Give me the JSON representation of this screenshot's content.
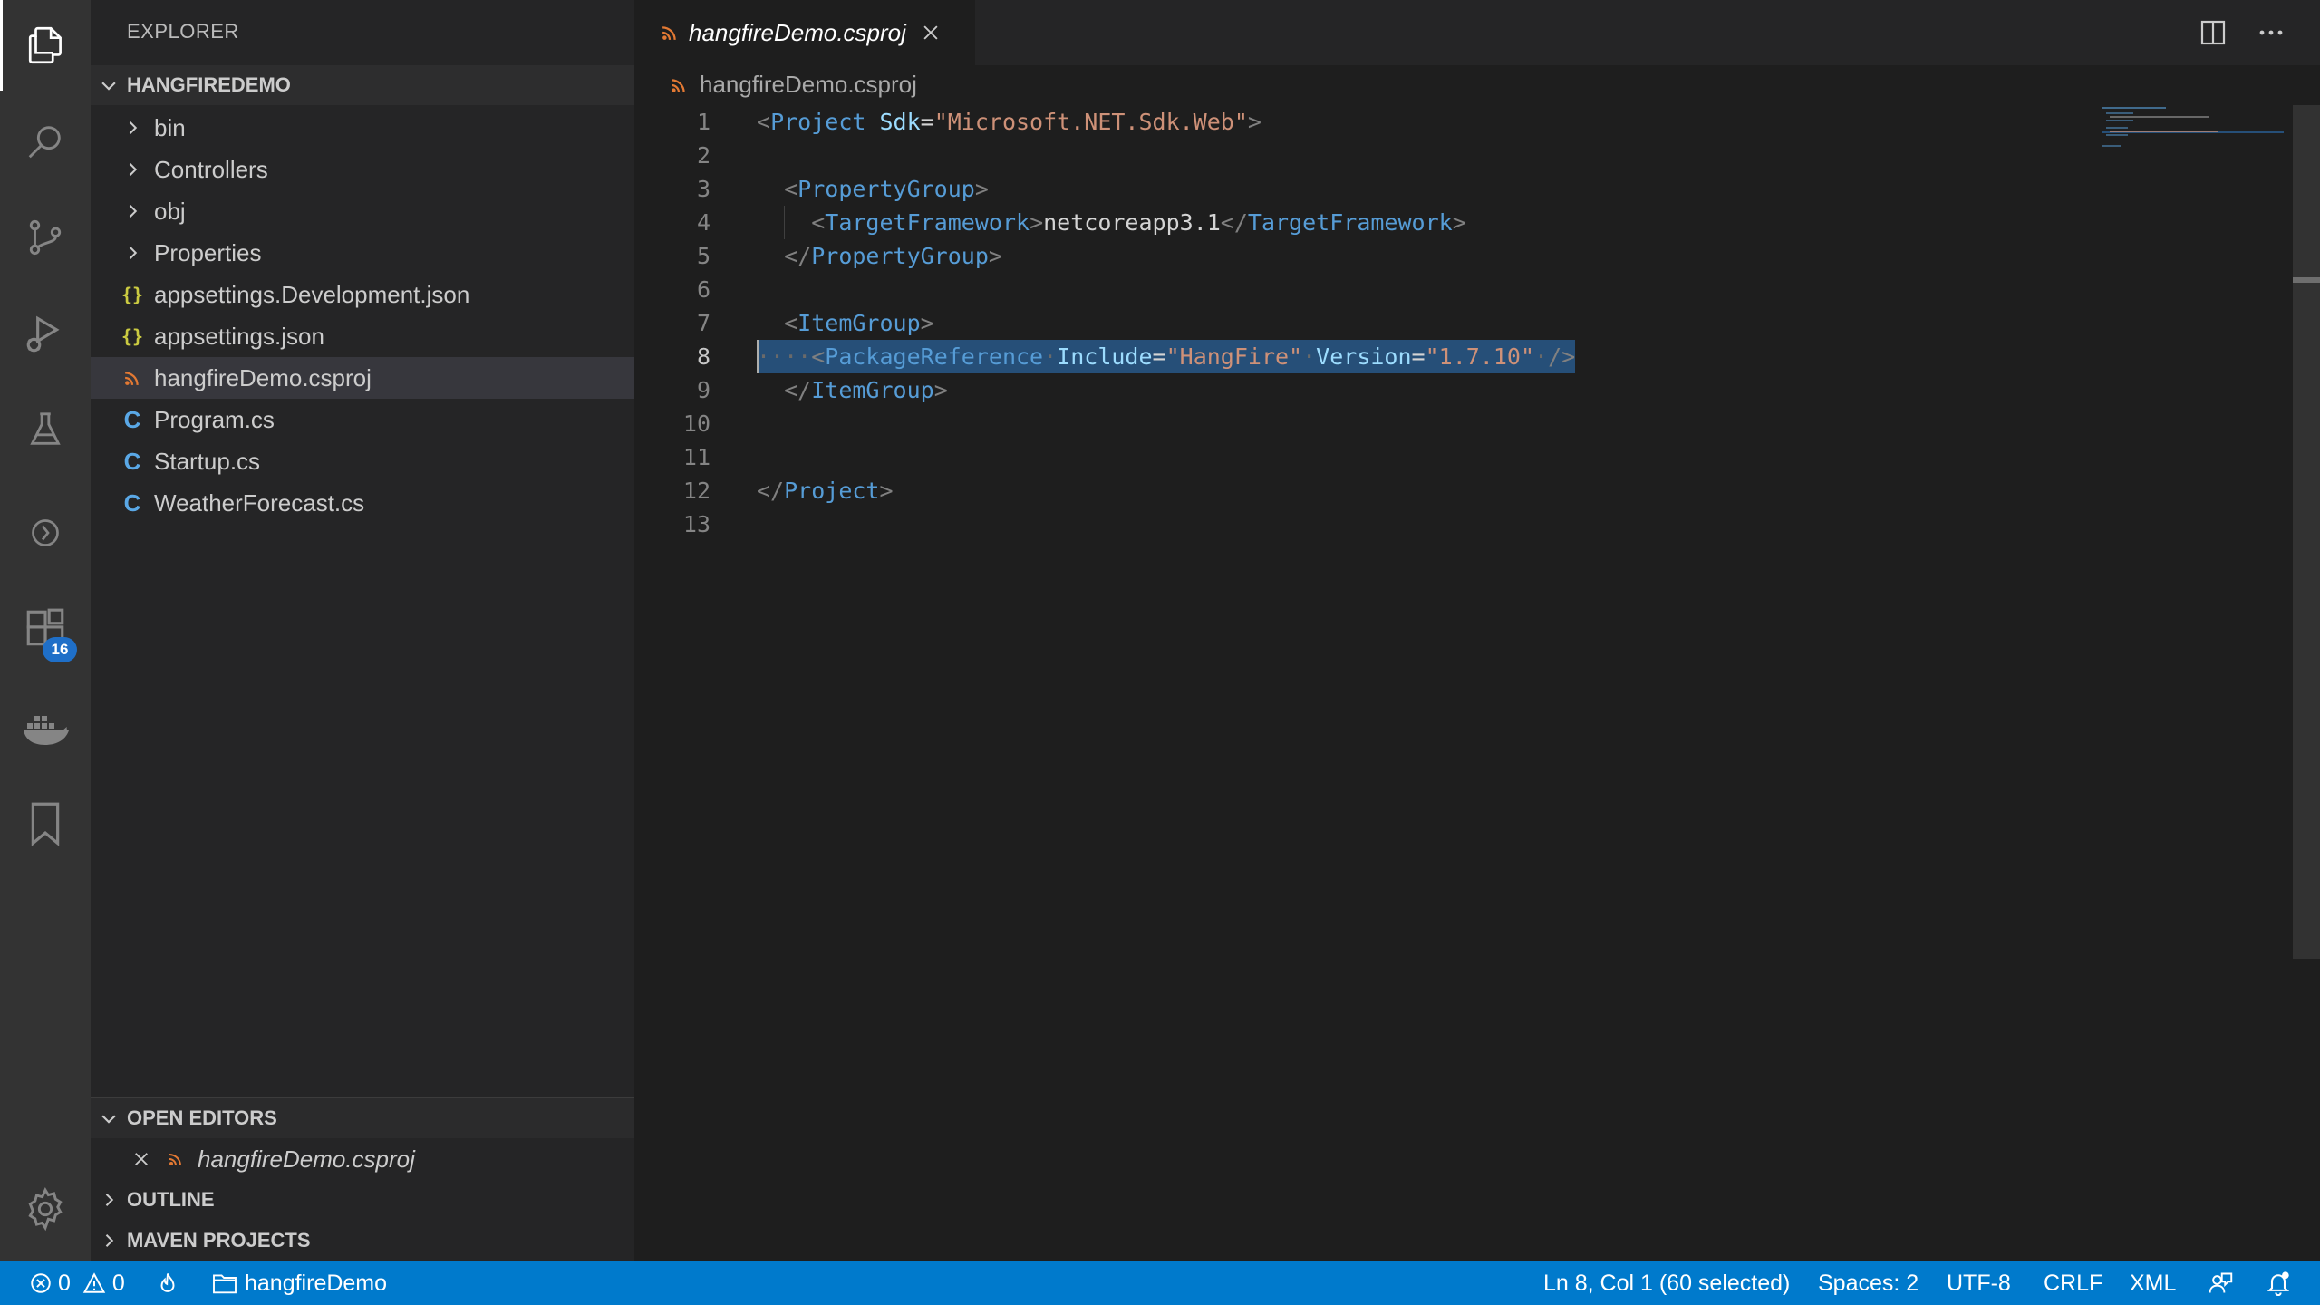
{
  "sidebar": {
    "title": "EXPLORER",
    "project": "HANGFIREDEMO",
    "tree": [
      {
        "label": "bin",
        "kind": "folder"
      },
      {
        "label": "Controllers",
        "kind": "folder"
      },
      {
        "label": "obj",
        "kind": "folder"
      },
      {
        "label": "Properties",
        "kind": "folder"
      },
      {
        "label": "appsettings.Development.json",
        "kind": "json"
      },
      {
        "label": "appsettings.json",
        "kind": "json"
      },
      {
        "label": "hangfireDemo.csproj",
        "kind": "rss",
        "selected": true
      },
      {
        "label": "Program.cs",
        "kind": "cs"
      },
      {
        "label": "Startup.cs",
        "kind": "cs"
      },
      {
        "label": "WeatherForecast.cs",
        "kind": "cs"
      }
    ],
    "open_editors": {
      "title": "OPEN EDITORS",
      "items": [
        "hangfireDemo.csproj"
      ]
    },
    "outline": "OUTLINE",
    "maven": "MAVEN PROJECTS"
  },
  "activity": {
    "extensions_badge": "16"
  },
  "editor": {
    "tab_label": "hangfireDemo.csproj",
    "breadcrumb": "hangfireDemo.csproj",
    "line_numbers": [
      "1",
      "2",
      "3",
      "4",
      "5",
      "6",
      "7",
      "8",
      "9",
      "10",
      "11",
      "12",
      "13"
    ],
    "selected_line": 8
  },
  "statusbar": {
    "errors": "0",
    "warnings": "0",
    "folder": "hangfireDemo",
    "position": "Ln 8, Col 1 (60 selected)",
    "spaces": "Spaces: 2",
    "encoding": "UTF-8",
    "eol": "CRLF",
    "language": "XML"
  },
  "colors": {
    "accent": "#007acc",
    "selection": "#264f78",
    "xml_tag": "#569cd6",
    "xml_attr": "#9cdcfe",
    "xml_string": "#ce9178",
    "rss_icon": "#e37933"
  }
}
